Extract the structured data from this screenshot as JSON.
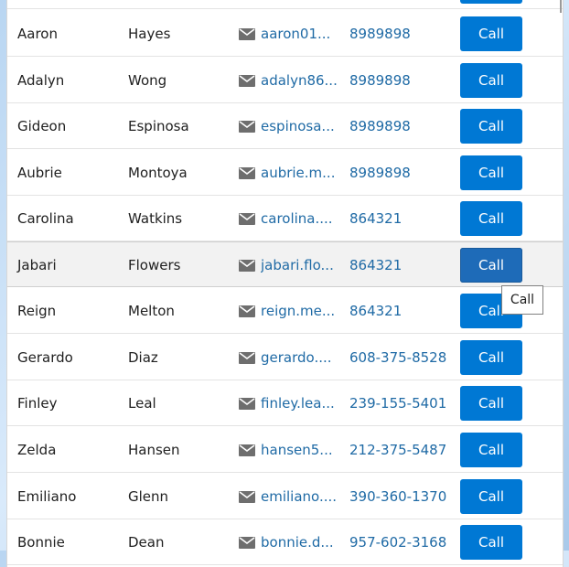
{
  "call_label": "Call",
  "tooltip": "Call",
  "contacts": [
    {
      "first": "",
      "last": "",
      "email": "",
      "phone": ""
    },
    {
      "first": "Aaron",
      "last": "Hayes",
      "email": "aaron01...",
      "phone": "8989898"
    },
    {
      "first": "Adalyn",
      "last": "Wong",
      "email": "adalyn86...",
      "phone": "8989898"
    },
    {
      "first": "Gideon",
      "last": "Espinosa",
      "email": "espinosa...",
      "phone": "8989898"
    },
    {
      "first": "Aubrie",
      "last": "Montoya",
      "email": "aubrie.m...",
      "phone": "8989898"
    },
    {
      "first": "Carolina",
      "last": "Watkins",
      "email": "carolina....",
      "phone": "864321"
    },
    {
      "first": "Jabari",
      "last": "Flowers",
      "email": "jabari.flo...",
      "phone": "864321"
    },
    {
      "first": "Reign",
      "last": "Melton",
      "email": "reign.me...",
      "phone": "864321"
    },
    {
      "first": "Gerardo",
      "last": "Diaz",
      "email": "gerardo....",
      "phone": "608-375-8528"
    },
    {
      "first": "Finley",
      "last": "Leal",
      "email": "finley.lea...",
      "phone": "239-155-5401"
    },
    {
      "first": "Zelda",
      "last": "Hansen",
      "email": "hansen5...",
      "phone": "212-375-5487"
    },
    {
      "first": "Emiliano",
      "last": "Glenn",
      "email": "emiliano....",
      "phone": "390-360-1370"
    },
    {
      "first": "Bonnie",
      "last": "Dean",
      "email": "bonnie.d...",
      "phone": "957-602-3168"
    }
  ],
  "colors": {
    "accent": "#0078d4",
    "link": "#1f6aa5",
    "selected_row": "#f2f2f2"
  },
  "icons": {
    "email": "envelope-icon"
  }
}
